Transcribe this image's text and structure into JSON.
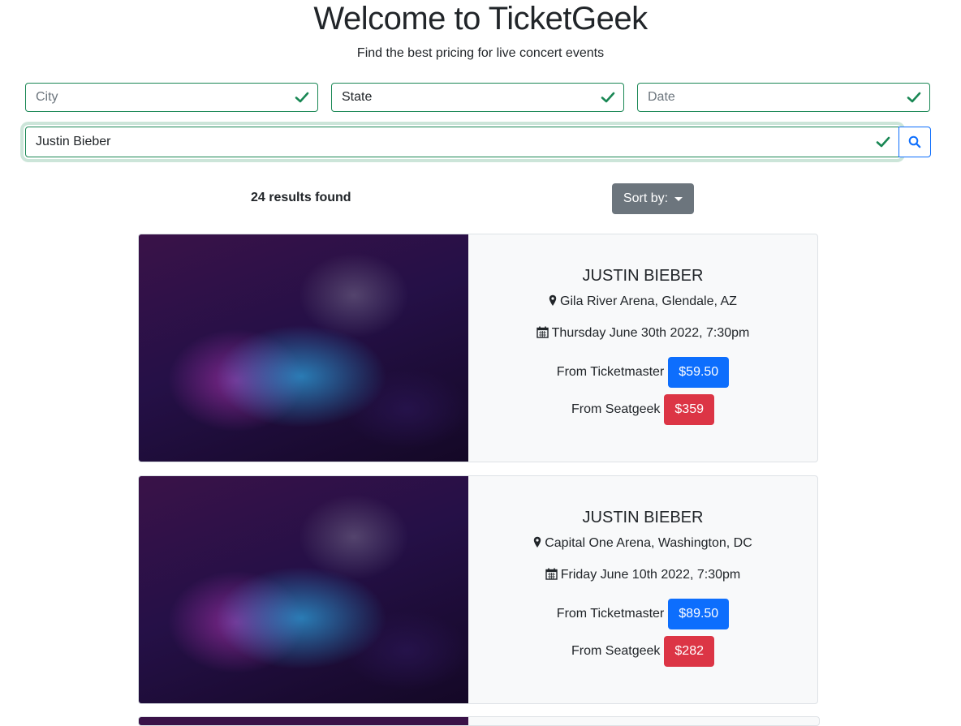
{
  "header": {
    "title": "Welcome to TicketGeek",
    "subtitle": "Find the best pricing for live concert events"
  },
  "filters": {
    "city_placeholder": "City",
    "state_value": "State",
    "date_placeholder": "Date",
    "search_value": "Justin Bieber"
  },
  "results": {
    "count_text": "24 results found",
    "sort_label": "Sort by:"
  },
  "events": [
    {
      "artist": "JUSTIN BIEBER",
      "venue": "Gila River Arena, Glendale, AZ",
      "date": "Thursday June 30th 2022, 7:30pm",
      "ticketmaster_label": "From Ticketmaster",
      "ticketmaster_price": "$59.50",
      "seatgeek_label": "From Seatgeek",
      "seatgeek_price": "$359"
    },
    {
      "artist": "JUSTIN BIEBER",
      "venue": "Capital One Arena, Washington, DC",
      "date": "Friday June 10th 2022, 7:30pm",
      "ticketmaster_label": "From Ticketmaster",
      "ticketmaster_price": "$89.50",
      "seatgeek_label": "From Seatgeek",
      "seatgeek_price": "$282"
    }
  ],
  "colors": {
    "valid_green": "#198754",
    "primary_blue": "#0d6efd",
    "danger_red": "#dc3545",
    "secondary_gray": "#6c757d"
  },
  "icons": {
    "valid": "check-icon",
    "search": "search-icon",
    "venue": "map-marker-icon",
    "date": "calendar-icon",
    "sort": "caret-down-icon"
  }
}
